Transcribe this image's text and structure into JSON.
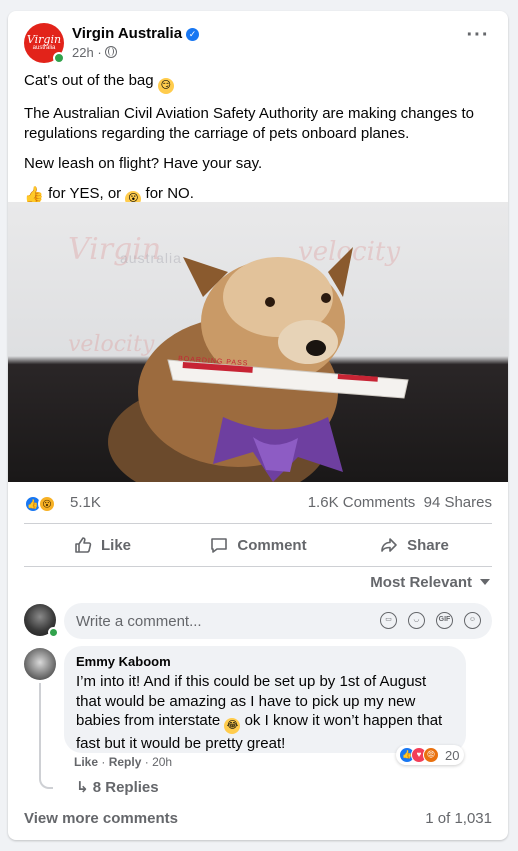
{
  "post": {
    "page_name": "Virgin Australia",
    "verified": true,
    "time": "22h",
    "separator": "·",
    "avatar_text": "Virgin",
    "avatar_subtext": "australia",
    "text_line1": "Cat's out of the bag",
    "text_line2": "The Australian Civil Aviation Safety Authority are making changes to regulations regarding the carriage of pets onboard planes.",
    "text_line3": "New leash on flight? Have your say.",
    "text_line4_a": "for YES, or",
    "text_line4_b": "for NO."
  },
  "photo": {
    "bg_logos": [
      "Virgin",
      "velocity",
      "velocity",
      "australia"
    ],
    "ticket_text": "BOARDING PASS"
  },
  "stats": {
    "reactions": "5.1K",
    "comments": "1.6K Comments",
    "shares": "94 Shares"
  },
  "actions": {
    "like": "Like",
    "comment": "Comment",
    "share": "Share"
  },
  "comments_section": {
    "sort_label": "Most Relevant",
    "input_placeholder": "Write a comment...",
    "input_icons": [
      "sticker-icon",
      "emoji-icon",
      "gif-icon",
      "avatar-sticker-icon"
    ],
    "gif_label": "GIF",
    "top_comment": {
      "author": "Emmy Kaboom",
      "text_a": "I’m into it! And if this could be set up by 1st of August that would be amazing as I have to pick up my new babies from interstate",
      "text_b": "ok I know it won’t happen that fast but it would be pretty great!",
      "reaction_count": "20",
      "like": "Like",
      "reply": "Reply",
      "time": "20h",
      "dot": "·"
    },
    "replies_label": "8 Replies",
    "view_more": "View more comments",
    "count": "1 of 1,031"
  },
  "colors": {
    "brand_red": "#e2231a",
    "fb_blue": "#1877f2",
    "online_green": "#31a24c",
    "secondary_text": "#65676b"
  }
}
